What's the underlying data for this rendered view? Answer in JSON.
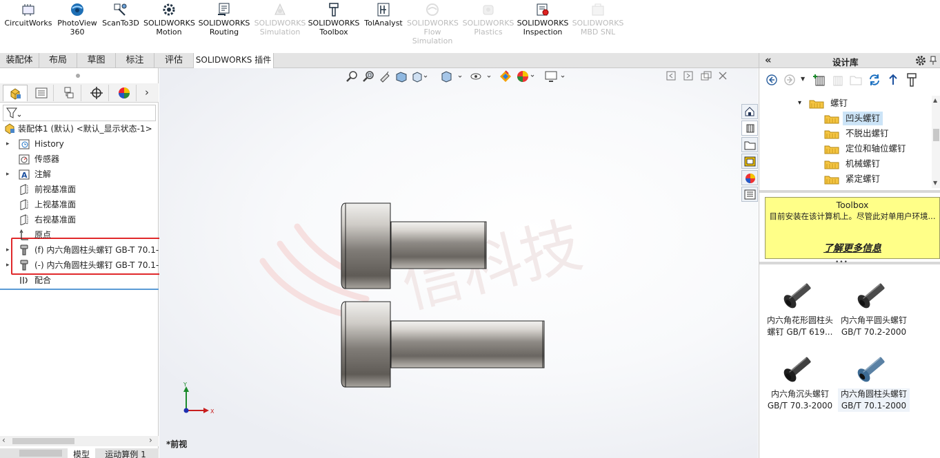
{
  "ribbon": [
    {
      "label": "CircuitWorks",
      "icon": "circuitworks-icon",
      "disabled": false
    },
    {
      "label": "PhotoView\n360",
      "icon": "photoview-icon",
      "disabled": false
    },
    {
      "label": "ScanTo3D",
      "icon": "scanto3d-icon",
      "disabled": false
    },
    {
      "label": "SOLIDWORKS\nMotion",
      "icon": "motion-icon",
      "disabled": false
    },
    {
      "label": "SOLIDWORKS\nRouting",
      "icon": "routing-icon",
      "disabled": false
    },
    {
      "label": "SOLIDWORKS\nSimulation",
      "icon": "simulation-icon",
      "disabled": true
    },
    {
      "label": "SOLIDWORKS\nToolbox",
      "icon": "toolbox-icon",
      "disabled": false
    },
    {
      "label": "TolAnalyst",
      "icon": "tolanalyst-icon",
      "disabled": false
    },
    {
      "label": "SOLIDWORKS\nFlow\nSimulation",
      "icon": "flow-simulation-icon",
      "disabled": true
    },
    {
      "label": "SOLIDWORKS\nPlastics",
      "icon": "plastics-icon",
      "disabled": true
    },
    {
      "label": "SOLIDWORKS\nInspection",
      "icon": "inspection-icon",
      "disabled": false
    },
    {
      "label": "SOLIDWORKS\nMBD SNL",
      "icon": "mbd-snl-icon",
      "disabled": true
    }
  ],
  "command_tabs": [
    "装配体",
    "布局",
    "草图",
    "标注",
    "评估",
    "SOLIDWORKS 插件"
  ],
  "active_tab_index": 5,
  "tree": {
    "root": "装配体1 (默认) <默认_显示状态-1>",
    "items": [
      {
        "label": "History",
        "icon": "history-icon",
        "expandable": true
      },
      {
        "label": "传感器",
        "icon": "sensor-icon",
        "expandable": false
      },
      {
        "label": "注解",
        "icon": "annotation-icon",
        "expandable": true
      },
      {
        "label": "前视基准面",
        "icon": "plane-icon",
        "expandable": false
      },
      {
        "label": "上视基准面",
        "icon": "plane-icon",
        "expandable": false
      },
      {
        "label": "右视基准面",
        "icon": "plane-icon",
        "expandable": false
      },
      {
        "label": "原点",
        "icon": "origin-icon",
        "expandable": false
      },
      {
        "label": "(f) 内六角圆柱头螺钉 GB-T 70.1-",
        "icon": "screw-icon",
        "expandable": true
      },
      {
        "label": "(-) 内六角圆柱头螺钉 GB-T 70.1-",
        "icon": "screw-icon",
        "expandable": true
      },
      {
        "label": "配合",
        "icon": "mates-icon",
        "expandable": false
      }
    ]
  },
  "bottom_tabs": [
    "模型",
    "运动算例 1"
  ],
  "viewport": {
    "view_name": "*前视",
    "axis_y": "Y",
    "axis_x": "X"
  },
  "design_library": {
    "title": "设计库",
    "folders": [
      {
        "label": "螺钉",
        "level": 0,
        "expanded": true,
        "selected": false
      },
      {
        "label": "凹头螺钉",
        "level": 1,
        "expanded": false,
        "selected": true
      },
      {
        "label": "不脱出螺钉",
        "level": 1,
        "expanded": false,
        "selected": false
      },
      {
        "label": "定位和轴位螺钉",
        "level": 1,
        "expanded": false,
        "selected": false
      },
      {
        "label": "机械螺钉",
        "level": 1,
        "expanded": false,
        "selected": false
      },
      {
        "label": "紧定螺钉",
        "level": 1,
        "expanded": false,
        "selected": false
      }
    ],
    "toolbox_title": "Toolbox",
    "toolbox_text": "目前安装在该计算机上。尽管此对单用户环境...",
    "toolbox_link": "了解更多信息",
    "parts": [
      {
        "label": "内六角花形圆柱头螺钉 GB/T 619...",
        "color": "#2b2b2b",
        "selected": false
      },
      {
        "label": "内六角平圆头螺钉 GB/T 70.2-2000",
        "color": "#2b2b2b",
        "selected": false
      },
      {
        "label": "内六角沉头螺钉 GB/T 70.3-2000",
        "color": "#1e1e1e",
        "selected": false
      },
      {
        "label": "内六角圆柱头螺钉 GB/T 70.1-2000",
        "color": "#3d6b94",
        "selected": true
      }
    ]
  },
  "watermark": "信科技",
  "colors": {
    "highlight": "#e0282a",
    "selected_folder": "#cce4f7",
    "toolbox_bg": "#ffff88"
  }
}
